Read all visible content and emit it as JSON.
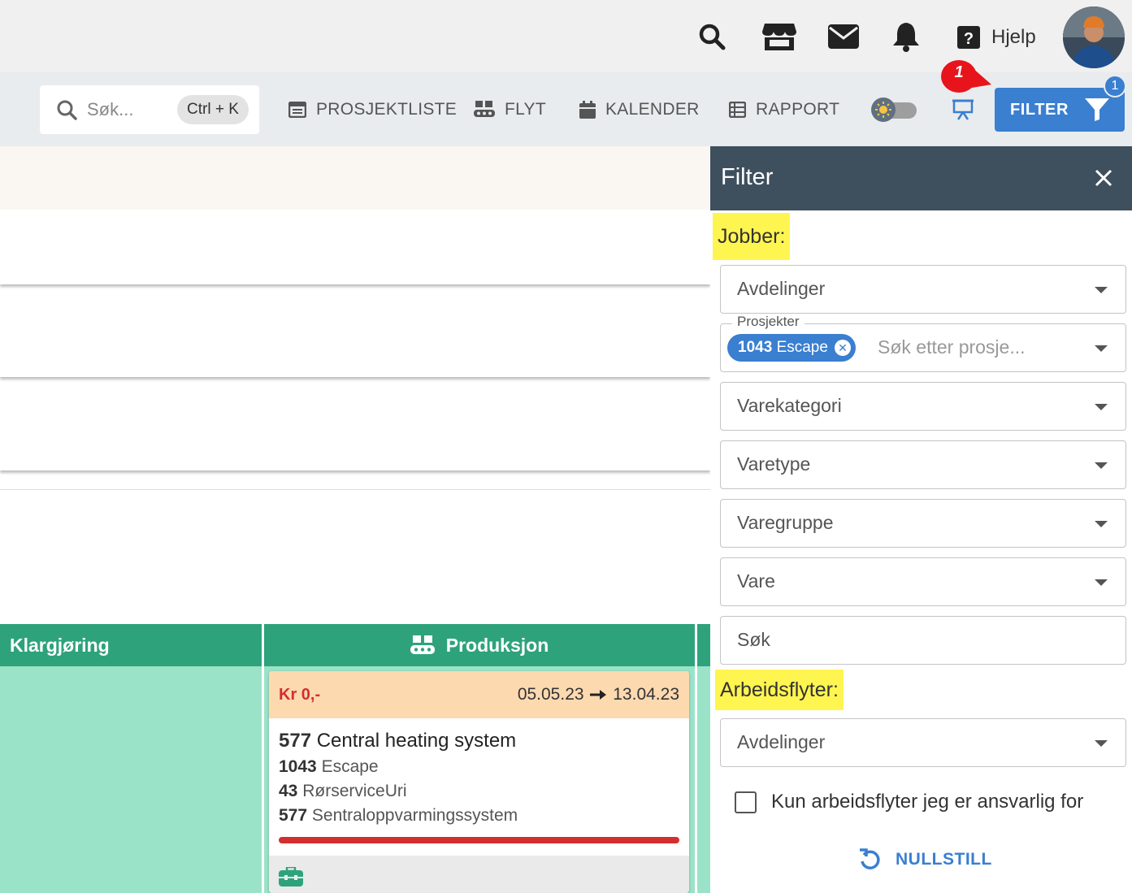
{
  "topbar": {
    "icons": [
      "search-icon",
      "store-icon",
      "mail-icon",
      "bell-icon"
    ],
    "help_label": "Hjelp"
  },
  "navbar": {
    "search_placeholder": "Søk...",
    "search_shortcut": "Ctrl + K",
    "items": [
      {
        "label": "PROSJEKTLISTE",
        "icon": "list-icon"
      },
      {
        "label": "FLYT",
        "icon": "conveyor-icon"
      },
      {
        "label": "KALENDER",
        "icon": "calendar-icon"
      },
      {
        "label": "RAPPORT",
        "icon": "report-icon"
      }
    ],
    "filter_label": "FILTER",
    "filter_count": "1",
    "annotation_number": "1"
  },
  "board": {
    "columns": [
      {
        "title": "Klargjøring"
      },
      {
        "title": "Produksjon"
      }
    ],
    "card": {
      "price": "Kr 0,-",
      "date_start": "05.05.23",
      "date_end": "13.04.23",
      "job_number": "577",
      "job_name": "Central heating system",
      "project_number": "1043",
      "project_name": "Escape",
      "customer_number": "43",
      "customer_name": "RørserviceUri",
      "item_number": "577",
      "item_name": "Sentraloppvarmingssystem"
    }
  },
  "filter_panel": {
    "title": "Filter",
    "jobs_heading": "Jobber:",
    "departments_label": "Avdelinger",
    "projects_legend": "Prosjekter",
    "project_chip_number": "1043",
    "project_chip_name": "Escape",
    "projects_placeholder": "Søk etter prosje...",
    "category_label": "Varekategori",
    "type_label": "Varetype",
    "group_label": "Varegruppe",
    "item_label": "Vare",
    "search_label": "Søk",
    "workflows_heading": "Arbeidsflyter:",
    "workflow_departments_label": "Avdelinger",
    "only_mine_label": "Kun arbeidsflyter jeg er ansvarlig for",
    "only_mine_checked": false,
    "reset_label": "NULLSTILL"
  },
  "colors": {
    "primary": "#3a7fd0",
    "panel_header": "#3e4f5e",
    "column_header": "#2ea37b",
    "column_body": "#9be3c8",
    "highlight": "#fff550",
    "danger": "#d32f2f",
    "card_header": "#fdd9b0"
  }
}
